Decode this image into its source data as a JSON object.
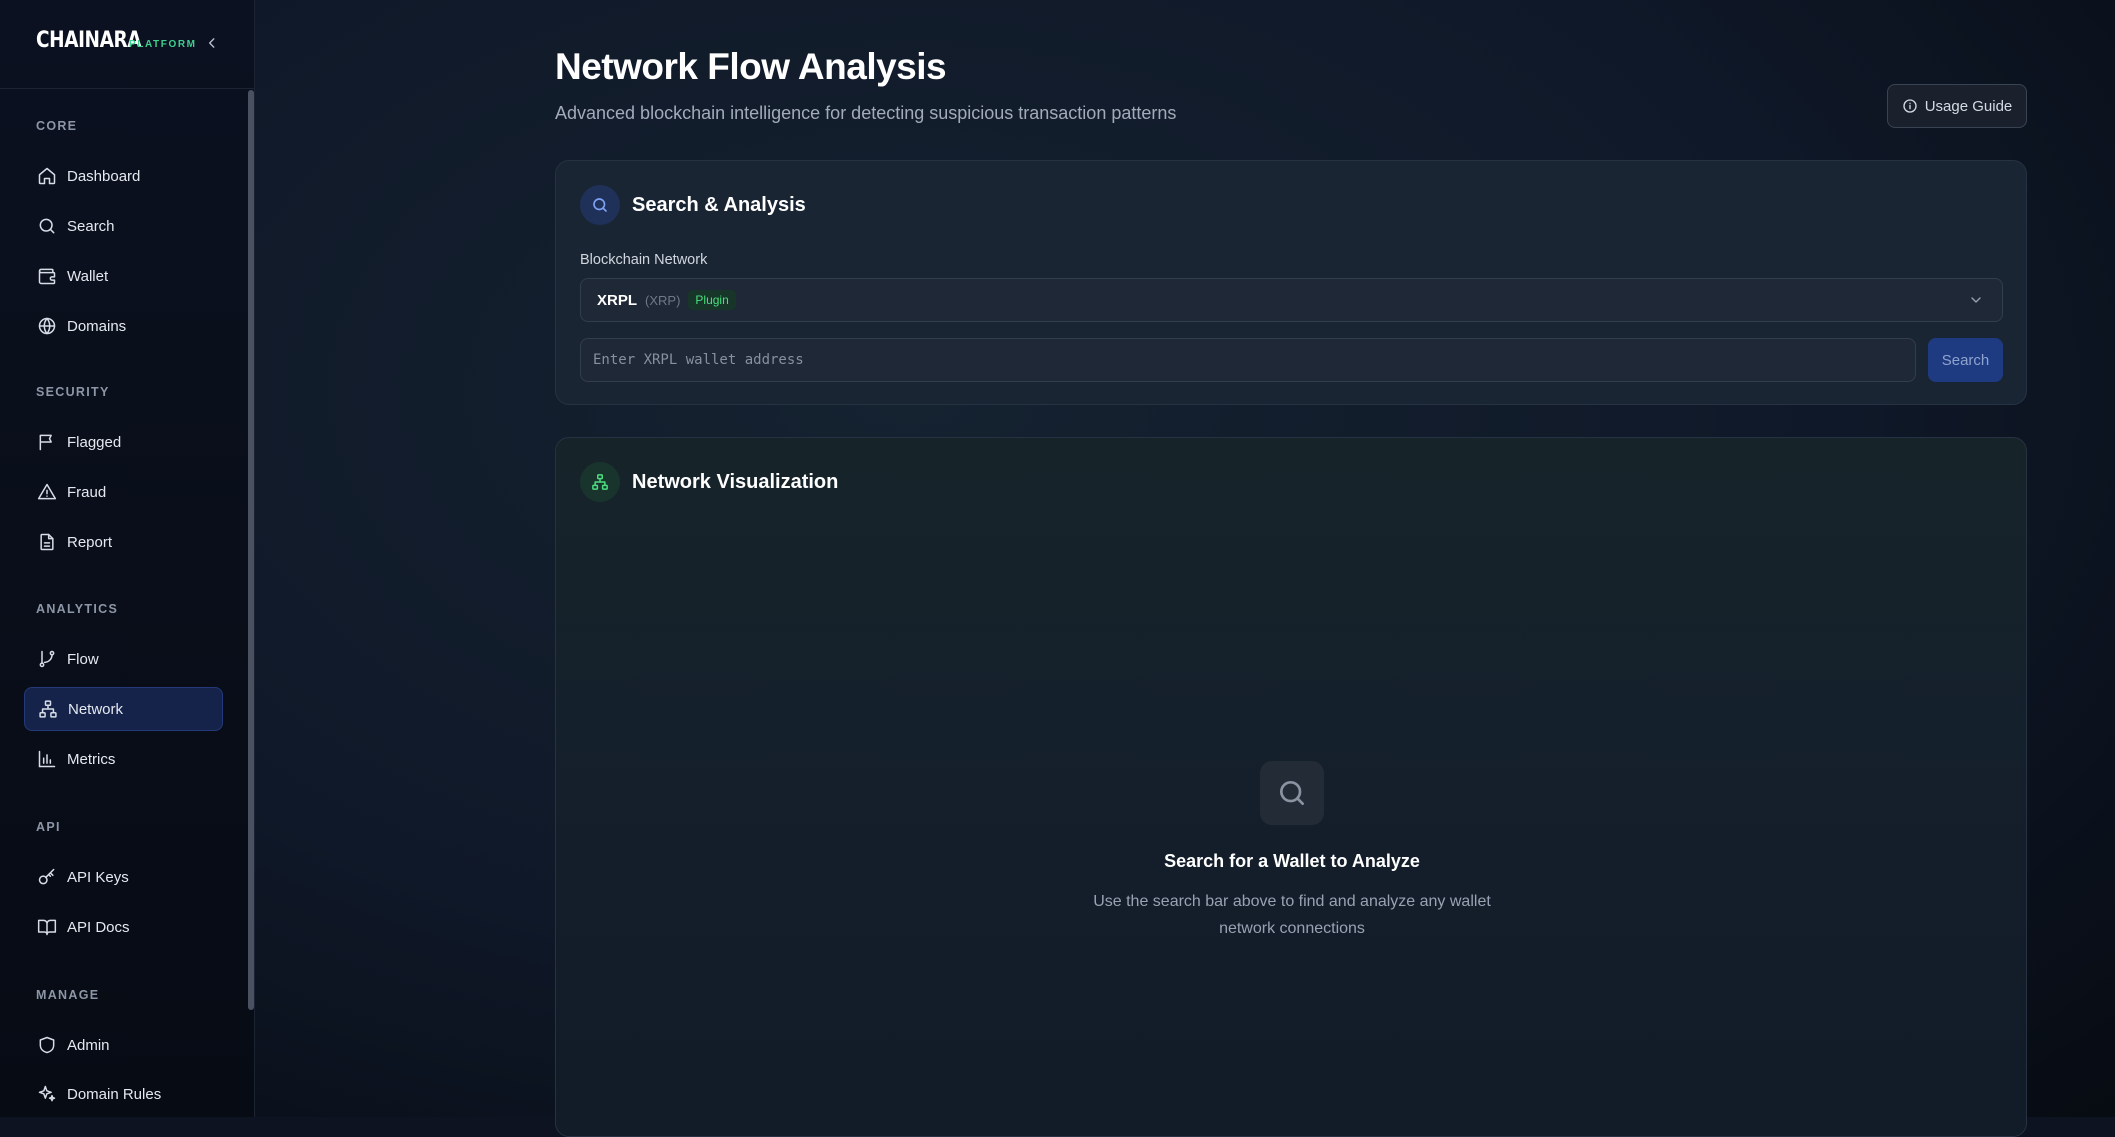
{
  "brand": {
    "logo": "CHAINARA",
    "tag": "PLATFORM"
  },
  "sidebar": {
    "sections": [
      {
        "title": "CORE",
        "items": [
          {
            "label": "Dashboard",
            "icon": "home-icon"
          },
          {
            "label": "Search",
            "icon": "search-icon"
          },
          {
            "label": "Wallet",
            "icon": "wallet-icon"
          },
          {
            "label": "Domains",
            "icon": "globe-icon"
          }
        ]
      },
      {
        "title": "SECURITY",
        "items": [
          {
            "label": "Flagged",
            "icon": "flag-icon"
          },
          {
            "label": "Fraud",
            "icon": "alert-triangle-icon"
          },
          {
            "label": "Report",
            "icon": "document-icon"
          }
        ]
      },
      {
        "title": "ANALYTICS",
        "items": [
          {
            "label": "Flow",
            "icon": "git-branch-icon"
          },
          {
            "label": "Network",
            "icon": "network-icon",
            "active": true
          },
          {
            "label": "Metrics",
            "icon": "bar-chart-icon"
          }
        ]
      },
      {
        "title": "API",
        "items": [
          {
            "label": "API Keys",
            "icon": "key-icon"
          },
          {
            "label": "API Docs",
            "icon": "book-icon"
          }
        ]
      },
      {
        "title": "MANAGE",
        "items": [
          {
            "label": "Admin",
            "icon": "shield-icon"
          },
          {
            "label": "Domain Rules",
            "icon": "sparkles-icon"
          }
        ]
      }
    ]
  },
  "header": {
    "title": "Network Flow Analysis",
    "subtitle": "Advanced blockchain intelligence for detecting suspicious transaction patterns",
    "usage_guide_label": "Usage Guide"
  },
  "search_card": {
    "title": "Search & Analysis",
    "network_label": "Blockchain Network",
    "selected_network": {
      "name": "XRPL",
      "symbol": "(XRP)",
      "badge": "Plugin"
    },
    "input_value": "",
    "input_placeholder": "Enter XRPL wallet address",
    "search_label": "Search"
  },
  "viz_card": {
    "title": "Network Visualization",
    "empty_title": "Search for a Wallet to Analyze",
    "empty_description": "Use the search bar above to find and analyze any wallet network connections"
  },
  "colors": {
    "accent_green": "#3fcf8e",
    "active_nav_bg": "#15234a",
    "search_button_bg": "#1e3b82",
    "plugin_badge_text": "#4ade80"
  }
}
